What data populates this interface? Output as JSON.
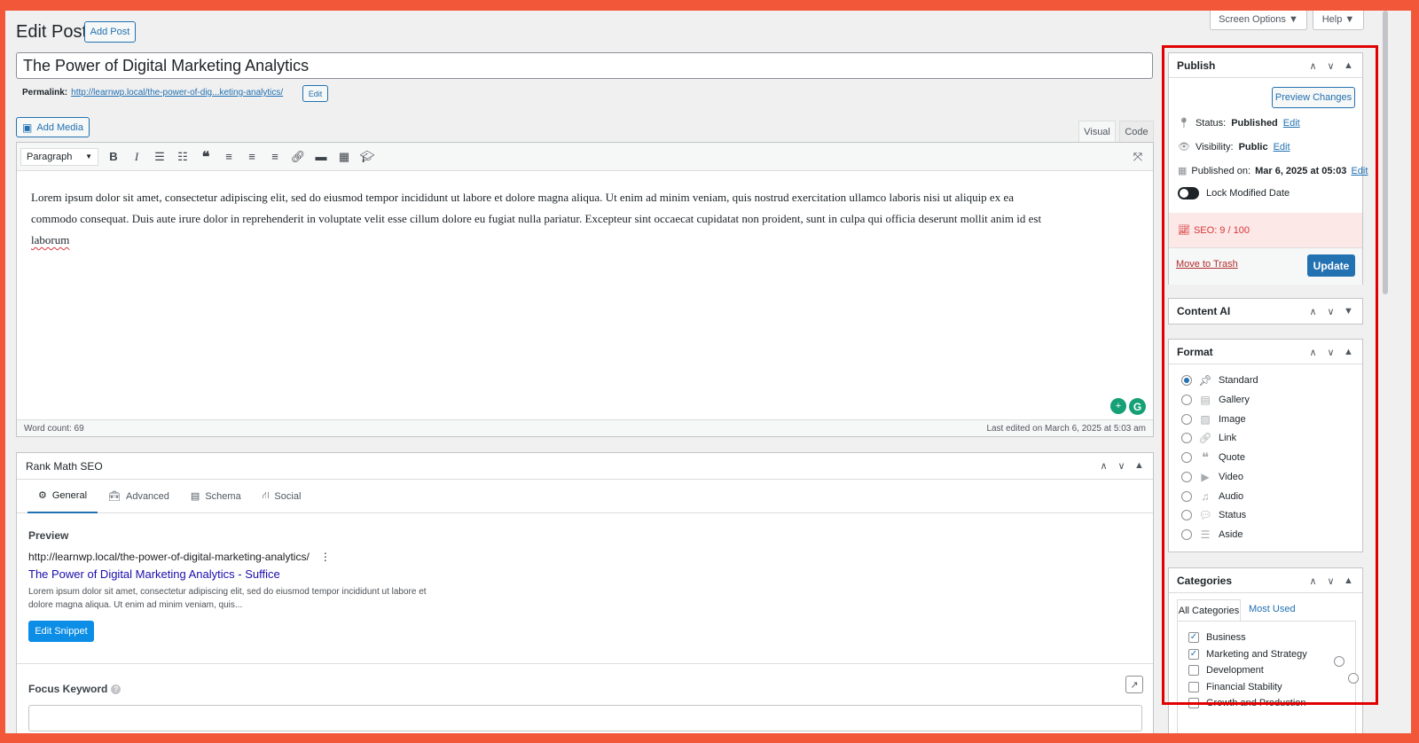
{
  "header": {
    "title": "Edit Post",
    "add_post": "Add Post",
    "screen_options": "Screen Options ▼",
    "help": "Help ▼"
  },
  "post": {
    "title": "The Power of Digital Marketing Analytics",
    "permalink_label": "Permalink:",
    "permalink_url": "http://learnwp.local/the-power-of-dig...keting-analytics/",
    "permalink_edit": "Edit"
  },
  "editor": {
    "add_media": "Add Media",
    "tab_visual": "Visual",
    "tab_code": "Code",
    "format_select": "Paragraph",
    "body_line1": "Lorem ipsum dolor sit amet, consectetur adipiscing elit, sed do eiusmod tempor incididunt ut labore et dolore magna aliqua. Ut enim ad minim veniam, quis nostrud exercitation ullamco laboris nisi ut aliquip ex ea",
    "body_line2": "commodo consequat. Duis aute irure dolor in reprehenderit in voluptate velit esse cillum dolore eu fugiat nulla pariatur. Excepteur sint occaecat cupidatat non proident, sunt in culpa qui officia deserunt mollit anim id est",
    "body_line3": "laborum",
    "word_count": "Word count: 69",
    "last_edited": "Last edited on March 6, 2025 at 5:03 am"
  },
  "rankmath": {
    "title": "Rank Math SEO",
    "tabs": [
      "General",
      "Advanced",
      "Schema",
      "Social"
    ],
    "preview_label": "Preview",
    "preview_url": "http://learnwp.local/the-power-of-digital-marketing-analytics/",
    "preview_title": "The Power of Digital Marketing Analytics - Suffice",
    "preview_desc1": "Lorem ipsum dolor sit amet, consectetur adipiscing elit, sed do eiusmod tempor incididunt ut labore et",
    "preview_desc2": "dolore magna aliqua. Ut enim ad minim veniam, quis...",
    "edit_snippet": "Edit Snippet",
    "focus_keyword": "Focus Keyword"
  },
  "publish": {
    "title": "Publish",
    "preview_changes": "Preview Changes",
    "status_label": "Status:",
    "status_value": "Published",
    "visibility_label": "Visibility:",
    "visibility_value": "Public",
    "published_label": "Published on:",
    "published_value": "Mar 6, 2025 at 05:03",
    "edit": "Edit",
    "lock_modified": "Lock Modified Date",
    "seo_score": "SEO: 9 / 100",
    "move_to_trash": "Move to Trash",
    "update": "Update"
  },
  "content_ai": {
    "title": "Content AI"
  },
  "format": {
    "title": "Format",
    "options": [
      "Standard",
      "Gallery",
      "Image",
      "Link",
      "Quote",
      "Video",
      "Audio",
      "Status",
      "Aside"
    ],
    "selected": "Standard"
  },
  "categories": {
    "title": "Categories",
    "tab_all": "All Categories",
    "tab_most_used": "Most Used",
    "items": [
      {
        "label": "Business",
        "checked": true
      },
      {
        "label": "Marketing and Strategy",
        "checked": true
      },
      {
        "label": "Development",
        "checked": false
      },
      {
        "label": "Financial Stability",
        "checked": false
      },
      {
        "label": "Growth and Production",
        "checked": false
      }
    ]
  },
  "colors": {
    "accent": "#2271b1",
    "highlight": "#e00000",
    "frame": "#f3573a",
    "seo_bg": "#fde8e8",
    "seo_text": "#d63638"
  }
}
